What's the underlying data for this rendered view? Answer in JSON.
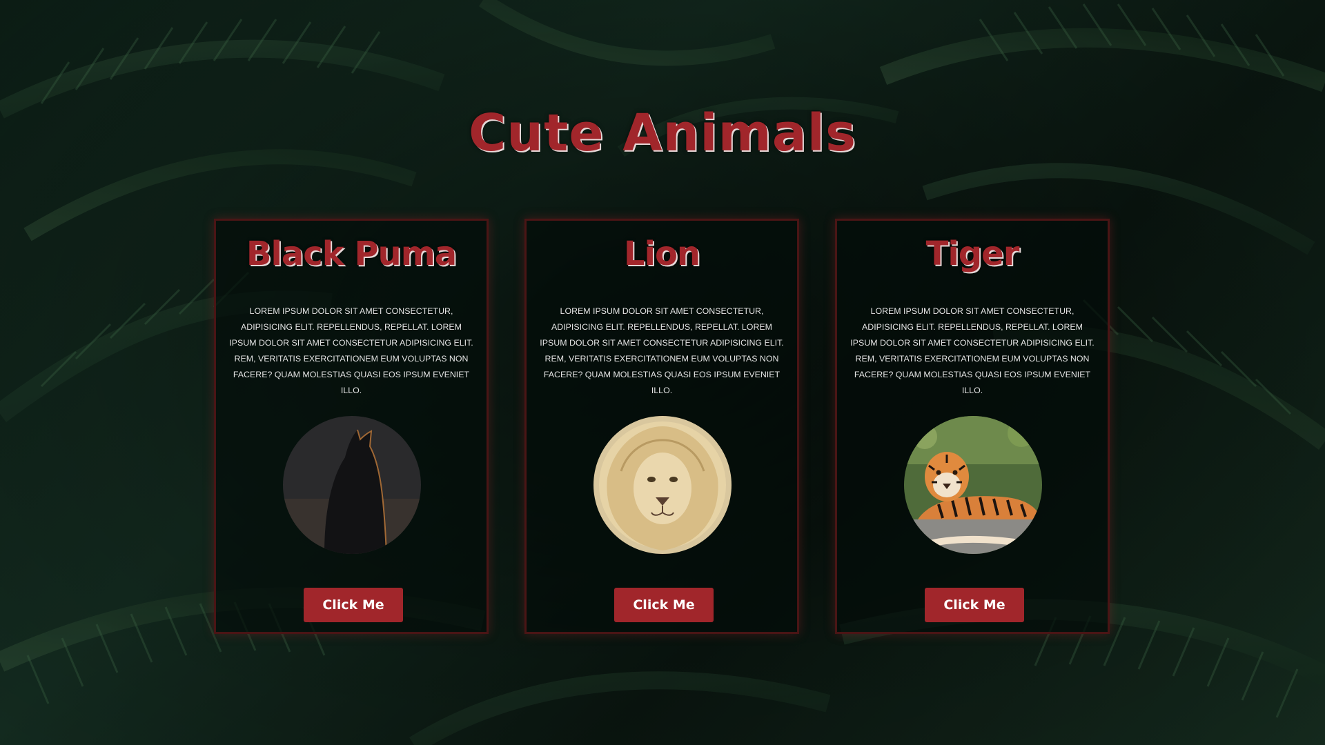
{
  "page": {
    "title": "Cute Animals",
    "accent_color": "#a1262b"
  },
  "cards": [
    {
      "title": "Black Puma",
      "text": "Lorem ipsum dolor sit amet consectetur, adipisicing elit. Repellendus, repellat. Lorem ipsum dolor sit amet consectetur adipisicing elit. Rem, veritatis exercitationem eum voluptas non facere? Quam molestias quasi eos ipsum eveniet illo.",
      "image": "black-puma-photo",
      "button_label": "Click Me"
    },
    {
      "title": "Lion",
      "text": "Lorem ipsum dolor sit amet consectetur, adipisicing elit. Repellendus, repellat. Lorem ipsum dolor sit amet consectetur adipisicing elit. Rem, veritatis exercitationem eum voluptas non facere? Quam molestias quasi eos ipsum eveniet illo.",
      "image": "lion-photo",
      "button_label": "Click Me"
    },
    {
      "title": "Tiger",
      "text": "Lorem ipsum dolor sit amet consectetur, adipisicing elit. Repellendus, repellat. Lorem ipsum dolor sit amet consectetur adipisicing elit. Rem, veritatis exercitationem eum voluptas non facere? Quam molestias quasi eos ipsum eveniet illo.",
      "image": "tiger-photo",
      "button_label": "Click Me"
    }
  ]
}
